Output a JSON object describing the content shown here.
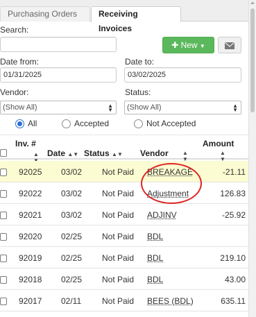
{
  "tabs": [
    "Purchasing Orders",
    "Receiving Invoices"
  ],
  "search": {
    "label": "Search:",
    "value": ""
  },
  "buttons": {
    "new_label": "New",
    "mail_icon": "envelope-icon"
  },
  "date_from": {
    "label": "Date from:",
    "value": "01/31/2025"
  },
  "date_to": {
    "label": "Date to:",
    "value": "03/02/2025"
  },
  "vendor": {
    "label": "Vendor:",
    "value": "(Show All)"
  },
  "status": {
    "label": "Status:",
    "value": "(Show All)"
  },
  "filter": {
    "options": [
      "All",
      "Accepted",
      "Not Accepted"
    ],
    "selected": "All"
  },
  "columns": {
    "inv": "Inv. #",
    "date": "Date",
    "status": "Status",
    "vendor": "Vendor",
    "amount": "Amount"
  },
  "rows": [
    {
      "inv": "92025",
      "date": "03/02",
      "status": "Not Paid",
      "vendor": "BREAKAGE",
      "amount": "-21.11"
    },
    {
      "inv": "92022",
      "date": "03/02",
      "status": "Not Paid",
      "vendor": "Adjustment",
      "amount": "126.83"
    },
    {
      "inv": "92021",
      "date": "03/02",
      "status": "Not Paid",
      "vendor": "ADJINV",
      "amount": "-25.92"
    },
    {
      "inv": "92020",
      "date": "02/25",
      "status": "Not Paid",
      "vendor": "BDL",
      "amount": ""
    },
    {
      "inv": "92019",
      "date": "02/25",
      "status": "Not Paid",
      "vendor": "BDL",
      "amount": "219.10"
    },
    {
      "inv": "92018",
      "date": "02/25",
      "status": "Not Paid",
      "vendor": "BDL",
      "amount": "43.00"
    },
    {
      "inv": "92017",
      "date": "02/11",
      "status": "Not Paid",
      "vendor": "BEES (BDL)",
      "amount": "635.11"
    }
  ],
  "colors": {
    "highlight_row": "#fcfcd2",
    "new_button": "#5cb85c",
    "annotation_circle": "#e02222"
  }
}
